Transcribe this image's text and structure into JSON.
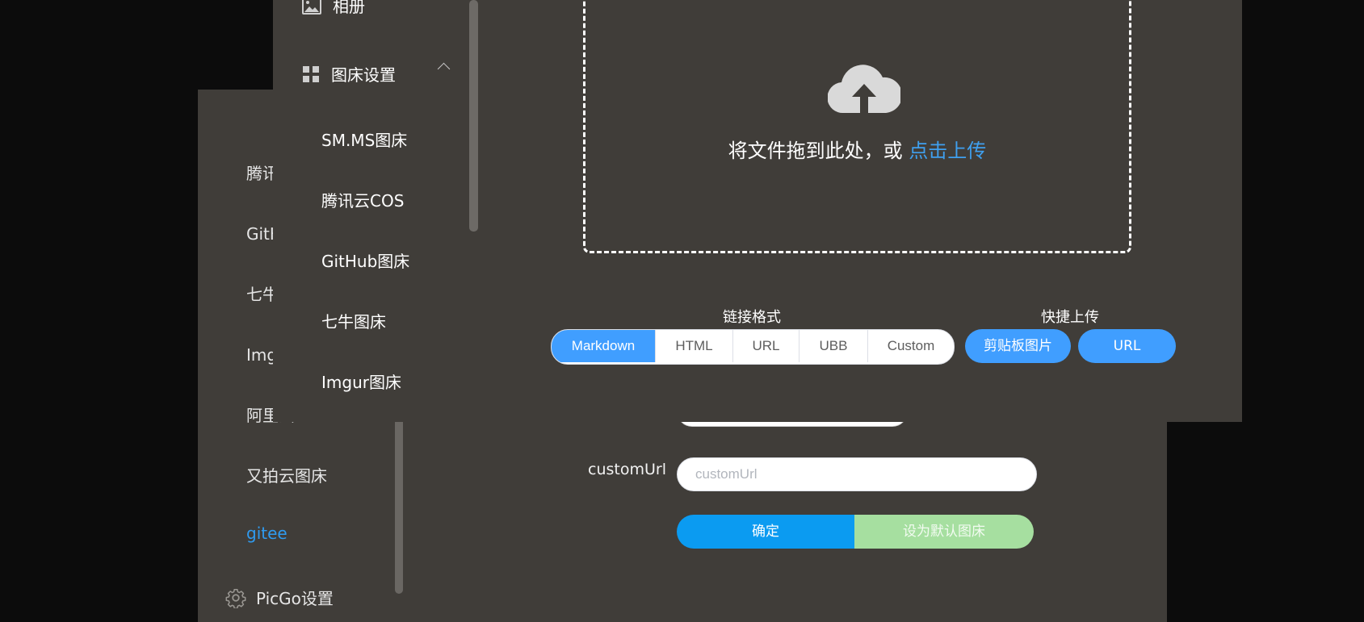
{
  "back_window": {
    "sidebar_items": [
      {
        "label": "腾讯云COS"
      },
      {
        "label": "GitHub图床"
      },
      {
        "label": "七牛图床"
      },
      {
        "label": "Imgur图床"
      },
      {
        "label": "阿里云OSS"
      },
      {
        "label": "又拍云图床"
      },
      {
        "label": "gitee",
        "active": true
      }
    ],
    "settings_label": "PicGo设置",
    "partial_input_placeholder": "customUrl",
    "custom_url_label": "customUrl",
    "custom_url_placeholder": "customUrl",
    "confirm_label": "确定",
    "set_default_label": "设为默认图床"
  },
  "front_window": {
    "album_label": "相册",
    "picbed_settings_label": "图床设置",
    "picbed_items": [
      "SM.MS图床",
      "腾讯云COS",
      "GitHub图床",
      "七牛图床",
      "Imgur图床"
    ],
    "dropzone": {
      "text": "将文件拖到此处，或 ",
      "link": "点击上传"
    },
    "link_format": {
      "label": "链接格式",
      "options": [
        "Markdown",
        "HTML",
        "URL",
        "UBB",
        "Custom"
      ],
      "selected": "Markdown"
    },
    "quick_upload": {
      "label": "快捷上传",
      "clipboard_label": "剪贴板图片",
      "url_label": "URL"
    }
  },
  "colors": {
    "window_bg": "#403d39",
    "accent_blue": "#409eff",
    "confirm_blue": "#0b9bf1",
    "default_green": "#a6dfa0",
    "active_link": "#2f9bf0"
  }
}
